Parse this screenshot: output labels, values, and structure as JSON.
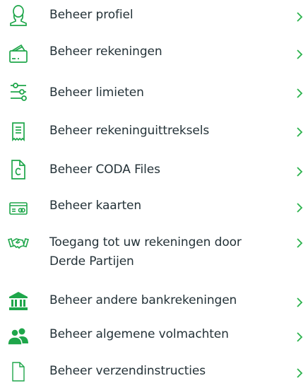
{
  "colors": {
    "accent": "#1ea64a",
    "text": "#243238",
    "chevron": "#2bb24c"
  },
  "menu": {
    "items": [
      {
        "label": "Beheer profiel",
        "icon": "user-profile-icon"
      },
      {
        "label": "Beheer rekeningen",
        "icon": "wallet-icon"
      },
      {
        "label": "Beheer limieten",
        "icon": "sliders-icon"
      },
      {
        "label": "Beheer rekeninguittreksels",
        "icon": "statement-icon"
      },
      {
        "label": "Beheer CODA Files",
        "icon": "coda-file-icon"
      },
      {
        "label": "Beheer kaarten",
        "icon": "card-icon"
      },
      {
        "label_line1": "Toegang tot uw rekeningen door",
        "label_line2": "Derde Partijen",
        "icon": "handshake-icon"
      },
      {
        "label": "Beheer andere bankrekeningen",
        "icon": "bank-icon"
      },
      {
        "label": "Beheer algemene volmachten",
        "icon": "people-icon"
      },
      {
        "label": "Beheer verzendinstructies",
        "icon": "document-icon"
      }
    ]
  }
}
